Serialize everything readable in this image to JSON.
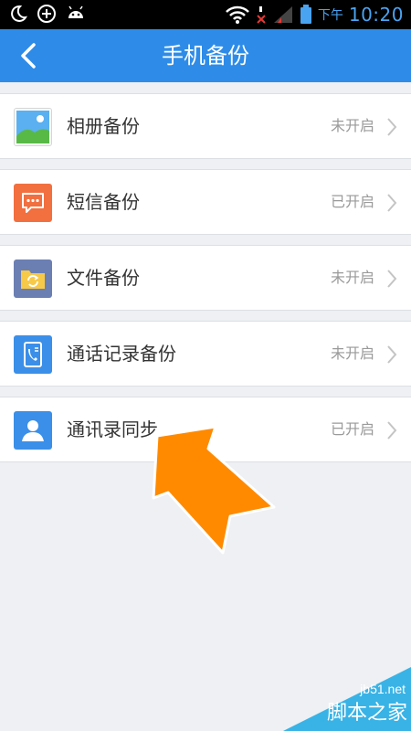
{
  "statusbar": {
    "ampm": "下午",
    "time": "10:20"
  },
  "header": {
    "title": "手机备份"
  },
  "items": [
    {
      "label": "相册备份",
      "status": "未开启",
      "icon": "photo-album-icon",
      "color": "#ffffff"
    },
    {
      "label": "短信备份",
      "status": "已开启",
      "icon": "message-icon",
      "color": "#f26f3f"
    },
    {
      "label": "文件备份",
      "status": "未开启",
      "icon": "folder-sync-icon",
      "color": "#6b7fb3"
    },
    {
      "label": "通话记录备份",
      "status": "未开启",
      "icon": "call-log-icon",
      "color": "#3b8fe8"
    },
    {
      "label": "通讯录同步",
      "status": "已开启",
      "icon": "contact-icon",
      "color": "#3b8fe8"
    }
  ],
  "watermark": {
    "site": "jb51.net",
    "name": "脚本之家"
  },
  "colors": {
    "header": "#2e8ce8",
    "arrow": "#ff8a00",
    "watermark": "#39b3e6"
  }
}
